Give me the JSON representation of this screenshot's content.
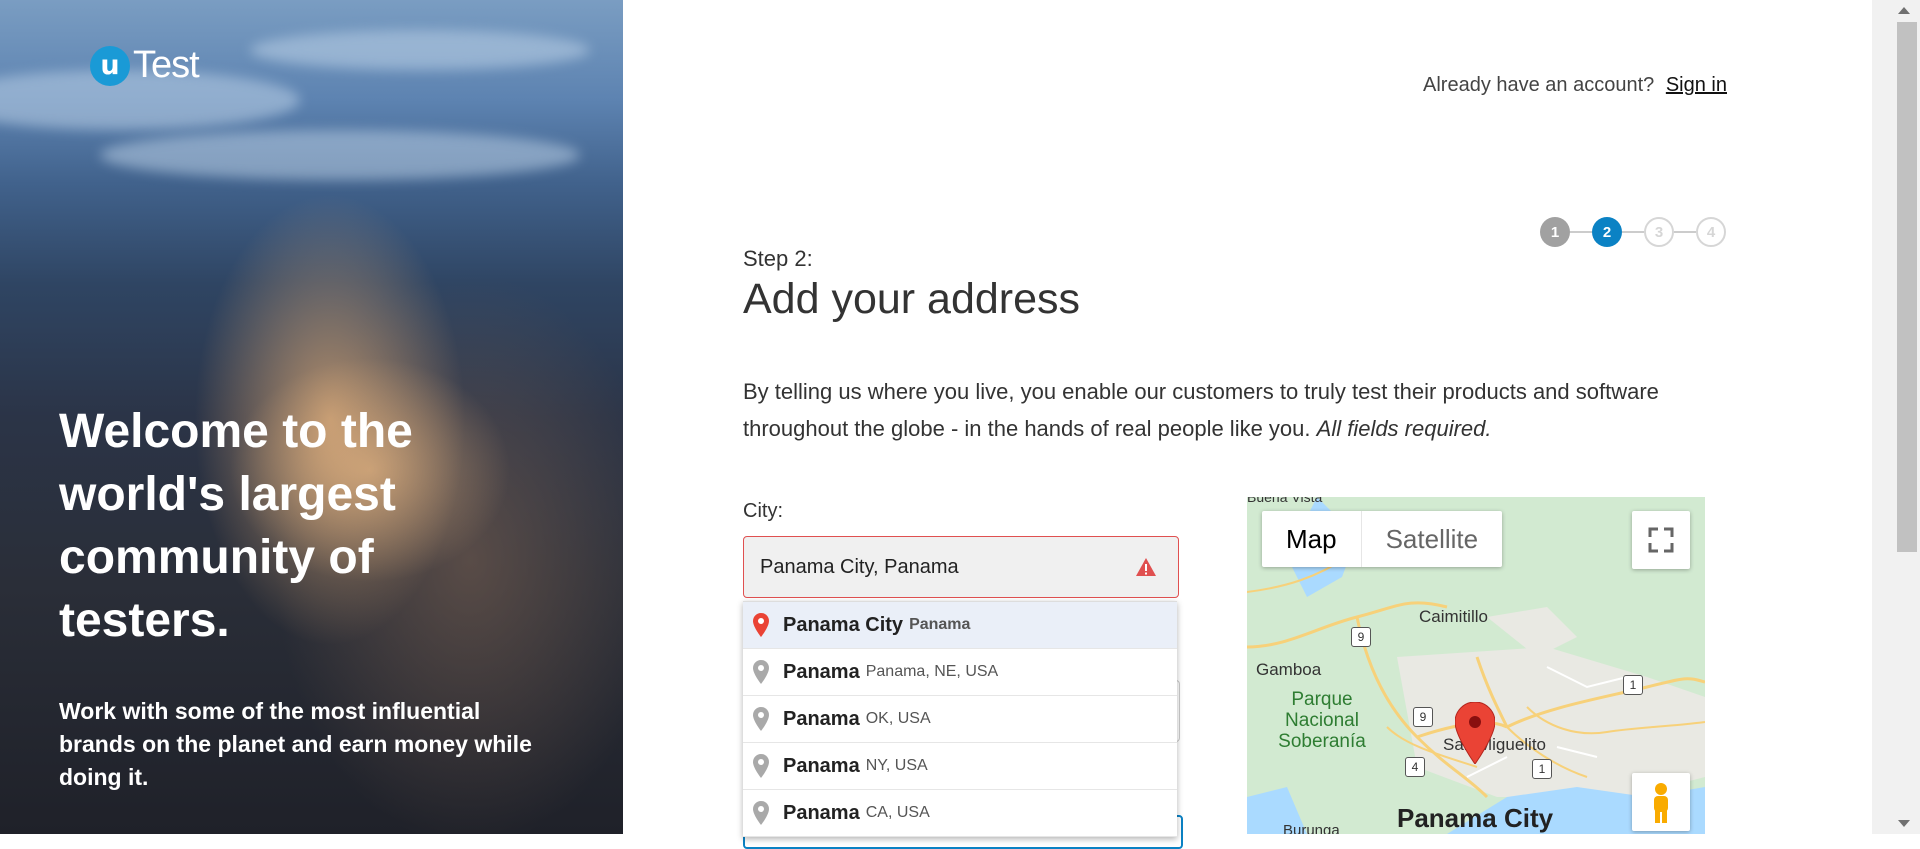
{
  "hero": {
    "logo_letter": "u",
    "logo_text": "Test",
    "headline": "Welcome to the world's largest community of testers.",
    "subtext": "Work with some of the most influential brands on the planet and earn money while doing it."
  },
  "header": {
    "already_text": "Already have an account?",
    "signin_label": "Sign in"
  },
  "stepper": {
    "steps": [
      "1",
      "2",
      "3",
      "4"
    ],
    "current": 2
  },
  "form": {
    "step_label": "Step 2:",
    "title": "Add your address",
    "description": "By telling us where you live, you enable our customers to truly test their products and software throughout the globe - in the hands of real people like you.",
    "description_italic": "All fields required.",
    "city_label": "City:",
    "city_value": "Panama City, Panama"
  },
  "suggestions": [
    {
      "main": "Panama City",
      "secondary": "Panama"
    },
    {
      "main": "Panama",
      "secondary": "Panama, NE, USA"
    },
    {
      "main": "Panama",
      "secondary": "OK, USA"
    },
    {
      "main": "Panama",
      "secondary": "NY, USA"
    },
    {
      "main": "Panama",
      "secondary": "CA, USA"
    }
  ],
  "map": {
    "map_label": "Map",
    "satellite_label": "Satellite",
    "places": {
      "caimitillo": "Caimitillo",
      "gamboa": "Gamboa",
      "parque": "Parque Nacional Soberanía",
      "san_miguelito": "San Miguelito",
      "panama_city": "Panama City",
      "burunga": "Burunga",
      "top": "Buena Vista"
    },
    "route_numbers": [
      "9",
      "1",
      "9",
      "4",
      "1"
    ]
  },
  "colors": {
    "accent": "#0b82c4",
    "logo": "#1a9ad6",
    "error": "#e05050",
    "pin": "#ea4335"
  }
}
